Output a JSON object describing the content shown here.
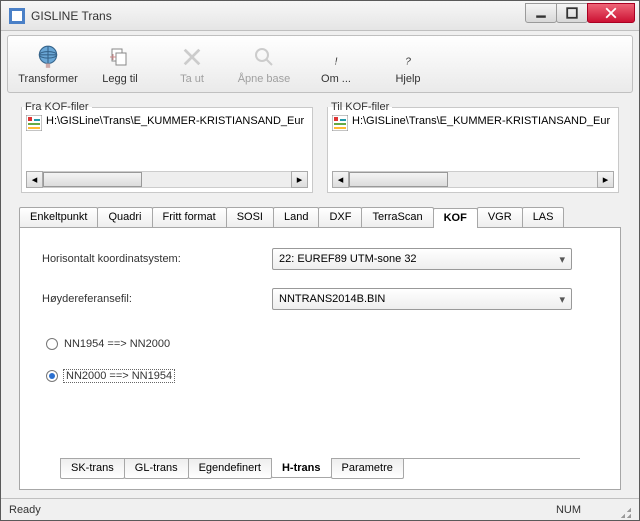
{
  "window": {
    "title": "GISLINE Trans"
  },
  "toolbar": {
    "items": [
      {
        "label": "Transformer",
        "disabled": false
      },
      {
        "label": "Legg til",
        "disabled": false
      },
      {
        "label": "Ta ut",
        "disabled": true
      },
      {
        "label": "Åpne base",
        "disabled": true
      },
      {
        "label": "Om ...",
        "disabled": false
      },
      {
        "label": "Hjelp",
        "disabled": false
      }
    ]
  },
  "filegroups": {
    "from": {
      "legend": "Fra KOF-filer",
      "path": "H:\\GISLine\\Trans\\E_KUMMER-KRISTIANSAND_Eur"
    },
    "to": {
      "legend": "Til KOF-filer",
      "path": "H:\\GISLine\\Trans\\E_KUMMER-KRISTIANSAND_Eur"
    }
  },
  "topTabs": [
    "Enkeltpunkt",
    "Quadri",
    "Fritt format",
    "SOSI",
    "Land",
    "DXF",
    "TerraScan",
    "KOF",
    "VGR",
    "LAS"
  ],
  "topTabActive": "KOF",
  "form": {
    "coordLabel": "Horisontalt koordinatsystem:",
    "coordValue": "22: EUREF89 UTM-sone 32",
    "refLabel": "Høydereferansefil:",
    "refValue": "NNTRANS2014B.BIN",
    "radio1": "NN1954 ==> NN2000",
    "radio2": "NN2000 ==> NN1954",
    "radioSelected": 2
  },
  "bottomTabs": [
    "SK-trans",
    "GL-trans",
    "Egendefinert",
    "H-trans",
    "Parametre"
  ],
  "bottomTabActive": "H-trans",
  "status": {
    "left": "Ready",
    "right": "NUM"
  }
}
